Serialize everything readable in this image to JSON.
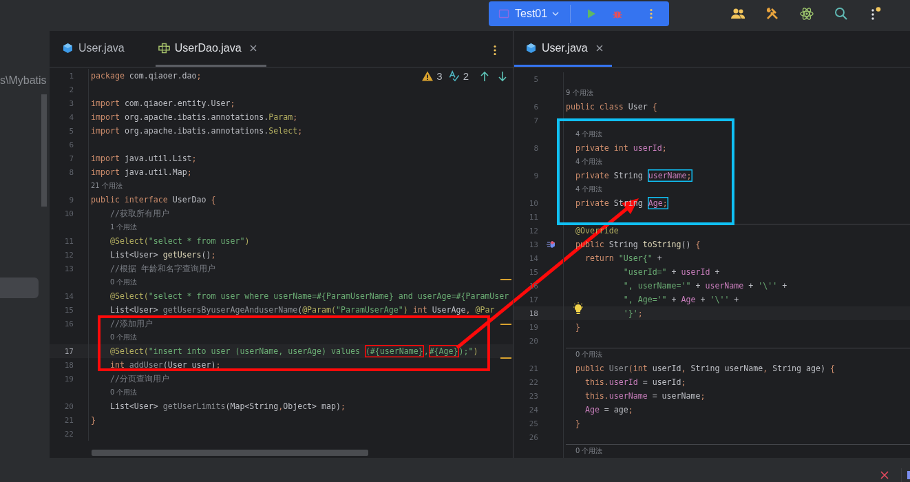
{
  "run_widget": {
    "config": "Test01"
  },
  "project_panel": {
    "path": "s\\Mybatis"
  },
  "editors": [
    {
      "focused": false,
      "tabs": [
        {
          "label": "User.java",
          "kind": "class",
          "selected": false,
          "closable": false
        },
        {
          "label": "UserDao.java",
          "kind": "interface",
          "selected": true,
          "closable": true
        }
      ],
      "inspections": [
        {
          "kind": "warning",
          "count": "3"
        },
        {
          "kind": "typo",
          "count": "2"
        }
      ],
      "lines": [
        {
          "kind": "code",
          "num": "1",
          "current": false,
          "segments": [
            {
              "kind": "kw",
              "text": "package "
            },
            {
              "kind": "pl",
              "text": "com.qiaoer.dao"
            },
            {
              "kind": "kw",
              "text": ";"
            }
          ]
        },
        {
          "kind": "code",
          "num": "2",
          "current": false
        },
        {
          "kind": "code",
          "num": "3",
          "current": false,
          "segments": [
            {
              "kind": "kw",
              "text": "import "
            },
            {
              "kind": "pl",
              "text": "com.qiaoer.entity.User"
            },
            {
              "kind": "kw",
              "text": ";"
            }
          ]
        },
        {
          "kind": "code",
          "num": "4",
          "current": false,
          "segments": [
            {
              "kind": "kw",
              "text": "import "
            },
            {
              "kind": "pl",
              "text": "org.apache.ibatis.annotations."
            },
            {
              "kind": "ann",
              "text": "Param"
            },
            {
              "kind": "kw",
              "text": ";"
            }
          ]
        },
        {
          "kind": "code",
          "num": "5",
          "current": false,
          "segments": [
            {
              "kind": "kw",
              "text": "import "
            },
            {
              "kind": "pl",
              "text": "org.apache.ibatis.annotations."
            },
            {
              "kind": "ann",
              "text": "Select"
            },
            {
              "kind": "kw",
              "text": ";"
            }
          ]
        },
        {
          "kind": "code",
          "num": "6",
          "current": false
        },
        {
          "kind": "code",
          "num": "7",
          "current": false,
          "segments": [
            {
              "kind": "kw",
              "text": "import "
            },
            {
              "kind": "pl",
              "text": "java.util.List"
            },
            {
              "kind": "kw",
              "text": ";"
            }
          ]
        },
        {
          "kind": "code",
          "num": "8",
          "current": false,
          "segments": [
            {
              "kind": "kw",
              "text": "import "
            },
            {
              "kind": "pl",
              "text": "java.util.Map"
            },
            {
              "kind": "kw",
              "text": ";"
            }
          ]
        },
        {
          "kind": "hint",
          "text": "21 个用法"
        },
        {
          "kind": "code",
          "num": "9",
          "current": false,
          "segments": [
            {
              "kind": "kw",
              "text": "public interface "
            },
            {
              "kind": "pl",
              "text": "UserDao "
            },
            {
              "kind": "kw",
              "text": "{"
            }
          ]
        },
        {
          "kind": "code",
          "num": "10",
          "current": false,
          "segments": [
            {
              "kind": "cmt",
              "text": "    //获取所有用户"
            }
          ]
        },
        {
          "kind": "hint",
          "text": "1 个用法"
        },
        {
          "kind": "code",
          "num": "11",
          "current": false,
          "segments": [
            {
              "kind": "ann",
              "text": "    @Select("
            },
            {
              "kind": "str",
              "text": "\"select * from user\""
            },
            {
              "kind": "ann",
              "text": ")"
            }
          ]
        },
        {
          "kind": "code",
          "num": "12",
          "current": false,
          "segments": [
            {
              "kind": "pl",
              "text": "    List<User> "
            },
            {
              "kind": "fn",
              "text": "getUsers"
            },
            {
              "kind": "pl",
              "text": "()"
            },
            {
              "kind": "kw",
              "text": ";"
            }
          ]
        },
        {
          "kind": "code",
          "num": "13",
          "current": false,
          "segments": [
            {
              "kind": "cmt",
              "text": "    //根据 年龄和名字查询用户"
            }
          ]
        },
        {
          "kind": "hint",
          "text": "0 个用法"
        },
        {
          "kind": "code",
          "num": "14",
          "current": false,
          "segments": [
            {
              "kind": "ann",
              "text": "    @Select("
            },
            {
              "kind": "str",
              "text": "\"select * from user where userName=#{ParamUserName} and userAge=#{ParamUser"
            }
          ]
        },
        {
          "kind": "code",
          "num": "15",
          "current": false,
          "segments": [
            {
              "kind": "pl",
              "text": "    List<User> "
            },
            {
              "kind": "un",
              "text": "getUsersByuserAgeAnduserName"
            },
            {
              "kind": "pl",
              "text": "("
            },
            {
              "kind": "ann",
              "text": "@Param("
            },
            {
              "kind": "str",
              "text": "\"ParamUserAge\""
            },
            {
              "kind": "ann",
              "text": ")"
            },
            {
              "kind": "kw",
              "text": " int "
            },
            {
              "kind": "pl",
              "text": "UserAge"
            },
            {
              "kind": "kw",
              "text": ", "
            },
            {
              "kind": "ann",
              "text": "@Par"
            }
          ]
        },
        {
          "kind": "code",
          "num": "16",
          "current": false,
          "segments": [
            {
              "kind": "cmt",
              "text": "    //添加用户"
            }
          ]
        },
        {
          "kind": "hint",
          "text": "0 个用法"
        },
        {
          "kind": "code",
          "num": "17",
          "current": true,
          "segments": [
            {
              "kind": "ann",
              "text": "    @Select("
            },
            {
              "kind": "str",
              "text": "\"insert into user (userName, userAge) values "
            },
            {
              "kind": "str",
              "text": "(#{userName}",
              "boxed": true
            },
            {
              "kind": "str",
              "text": ","
            },
            {
              "kind": "str",
              "text": "#{Age}",
              "boxed": true
            },
            {
              "kind": "str",
              "text": ");\""
            },
            {
              "kind": "ann",
              "text": ")"
            }
          ]
        },
        {
          "kind": "code",
          "num": "18",
          "current": false,
          "segments": [
            {
              "kind": "kw",
              "text": "    int "
            },
            {
              "kind": "un",
              "text": "addUser"
            },
            {
              "kind": "pl",
              "text": "(User user)"
            },
            {
              "kind": "kw",
              "text": ";"
            }
          ]
        },
        {
          "kind": "code",
          "num": "19",
          "current": false,
          "segments": [
            {
              "kind": "cmt",
              "text": "    //分页查询用户"
            }
          ]
        },
        {
          "kind": "hint",
          "text": "0 个用法"
        },
        {
          "kind": "code",
          "num": "20",
          "current": false,
          "segments": [
            {
              "kind": "pl",
              "text": "    List<User> "
            },
            {
              "kind": "un",
              "text": "getUserLimits"
            },
            {
              "kind": "pl",
              "text": "(Map<String"
            },
            {
              "kind": "kw",
              "text": ","
            },
            {
              "kind": "pl",
              "text": "Object> map)"
            },
            {
              "kind": "kw",
              "text": ";"
            }
          ]
        },
        {
          "kind": "code",
          "num": "21",
          "current": false,
          "segments": [
            {
              "kind": "kw",
              "text": "}"
            }
          ]
        },
        {
          "kind": "code",
          "num": "22",
          "current": false
        }
      ]
    },
    {
      "focused": true,
      "tabs": [
        {
          "label": "User.java",
          "kind": "class",
          "selected": true,
          "closable": true
        }
      ],
      "lines": [
        {
          "kind": "code",
          "num": "5",
          "current": false
        },
        {
          "kind": "hint",
          "text": "9 个用法"
        },
        {
          "kind": "code",
          "num": "6",
          "current": false,
          "segments": [
            {
              "kind": "kw",
              "text": "public class "
            },
            {
              "kind": "pl",
              "text": "User "
            },
            {
              "kind": "kw",
              "text": "{"
            }
          ]
        },
        {
          "kind": "code",
          "num": "7",
          "current": false
        },
        {
          "kind": "hint",
          "text": "4 个用法"
        },
        {
          "kind": "code",
          "num": "8",
          "current": false,
          "segments": [
            {
              "kind": "kw",
              "text": "  private int "
            },
            {
              "kind": "fld",
              "text": "userId"
            },
            {
              "kind": "kw",
              "text": ";"
            }
          ]
        },
        {
          "kind": "hint",
          "text": "4 个用法"
        },
        {
          "kind": "code",
          "num": "9",
          "current": false,
          "segments": [
            {
              "kind": "kw",
              "text": "  private "
            },
            {
              "kind": "pl",
              "text": "String "
            },
            {
              "kind": "fld",
              "text": "userName",
              "boxed": true
            },
            {
              "kind": "kw",
              "text": ";",
              "boxed": true
            }
          ]
        },
        {
          "kind": "hint",
          "text": "4 个用法"
        },
        {
          "kind": "code",
          "num": "10",
          "current": false,
          "segments": [
            {
              "kind": "kw",
              "text": "  private "
            },
            {
              "kind": "pl",
              "text": "String "
            },
            {
              "kind": "fld",
              "text": "Age",
              "boxed": true
            },
            {
              "kind": "kw",
              "text": ";",
              "boxed": true
            }
          ]
        },
        {
          "kind": "code",
          "num": "11",
          "current": false
        },
        {
          "kind": "separator"
        },
        {
          "kind": "code",
          "num": "12",
          "current": false,
          "segments": [
            {
              "kind": "ann",
              "text": "  @Override"
            }
          ]
        },
        {
          "kind": "code",
          "num": "13",
          "current": false,
          "gutter": {
            "kind": "override"
          },
          "segments": [
            {
              "kind": "kw",
              "text": "  public "
            },
            {
              "kind": "pl",
              "text": "String "
            },
            {
              "kind": "fn",
              "text": "toString"
            },
            {
              "kind": "pl",
              "text": "() "
            },
            {
              "kind": "kw",
              "text": "{"
            }
          ]
        },
        {
          "kind": "code",
          "num": "14",
          "current": false,
          "segments": [
            {
              "kind": "kw",
              "text": "    return "
            },
            {
              "kind": "str",
              "text": "\"User{\""
            },
            {
              "kind": "pl",
              "text": " +"
            }
          ]
        },
        {
          "kind": "code",
          "num": "15",
          "current": false,
          "segments": [
            {
              "kind": "str",
              "text": "            \"userId=\""
            },
            {
              "kind": "pl",
              "text": " + "
            },
            {
              "kind": "fld",
              "text": "userId"
            },
            {
              "kind": "pl",
              "text": " +"
            }
          ]
        },
        {
          "kind": "code",
          "num": "16",
          "current": false,
          "segments": [
            {
              "kind": "str",
              "text": "            \", userName='\""
            },
            {
              "kind": "pl",
              "text": " + "
            },
            {
              "kind": "fld",
              "text": "userName"
            },
            {
              "kind": "pl",
              "text": " + "
            },
            {
              "kind": "str",
              "text": "'\\''"
            },
            {
              "kind": "pl",
              "text": " +"
            }
          ]
        },
        {
          "kind": "code",
          "num": "17",
          "current": false,
          "segments": [
            {
              "kind": "str",
              "text": "            \", Age='\""
            },
            {
              "kind": "pl",
              "text": " + "
            },
            {
              "kind": "fld",
              "text": "Age"
            },
            {
              "kind": "pl",
              "text": " + "
            },
            {
              "kind": "str",
              "text": "'\\''"
            },
            {
              "kind": "pl",
              "text": " +"
            }
          ]
        },
        {
          "kind": "code",
          "num": "18",
          "current": true,
          "gutter": {
            "kind": "bulb"
          },
          "segments": [
            {
              "kind": "str",
              "text": "            '}'"
            },
            {
              "kind": "kw",
              "text": ";"
            }
          ]
        },
        {
          "kind": "code",
          "num": "19",
          "current": false,
          "segments": [
            {
              "kind": "kw",
              "text": "  }"
            }
          ]
        },
        {
          "kind": "code",
          "num": "20",
          "current": false
        },
        {
          "kind": "separator"
        },
        {
          "kind": "hint",
          "text": "0 个用法"
        },
        {
          "kind": "code",
          "num": "21",
          "current": false,
          "segments": [
            {
              "kind": "kw",
              "text": "  public "
            },
            {
              "kind": "un",
              "text": "User"
            },
            {
              "kind": "kw",
              "text": "(int "
            },
            {
              "kind": "pl",
              "text": "userId"
            },
            {
              "kind": "kw",
              "text": ", "
            },
            {
              "kind": "pl",
              "text": "String userName"
            },
            {
              "kind": "kw",
              "text": ", "
            },
            {
              "kind": "pl",
              "text": "String age) "
            },
            {
              "kind": "kw",
              "text": "{"
            }
          ]
        },
        {
          "kind": "code",
          "num": "22",
          "current": false,
          "segments": [
            {
              "kind": "kw",
              "text": "    this."
            },
            {
              "kind": "fld",
              "text": "userId"
            },
            {
              "kind": "pl",
              "text": " = userId"
            },
            {
              "kind": "kw",
              "text": ";"
            }
          ]
        },
        {
          "kind": "code",
          "num": "23",
          "current": false,
          "segments": [
            {
              "kind": "kw",
              "text": "    this."
            },
            {
              "kind": "fld",
              "text": "userName"
            },
            {
              "kind": "pl",
              "text": " = userName"
            },
            {
              "kind": "kw",
              "text": ";"
            }
          ]
        },
        {
          "kind": "code",
          "num": "24",
          "current": false,
          "segments": [
            {
              "kind": "fld",
              "text": "    Age"
            },
            {
              "kind": "pl",
              "text": " = age"
            },
            {
              "kind": "kw",
              "text": ";"
            }
          ]
        },
        {
          "kind": "code",
          "num": "25",
          "current": false,
          "segments": [
            {
              "kind": "kw",
              "text": "  }"
            }
          ]
        },
        {
          "kind": "code",
          "num": "26",
          "current": false
        },
        {
          "kind": "separator"
        },
        {
          "kind": "hint",
          "text": "0 个用法"
        }
      ]
    }
  ]
}
